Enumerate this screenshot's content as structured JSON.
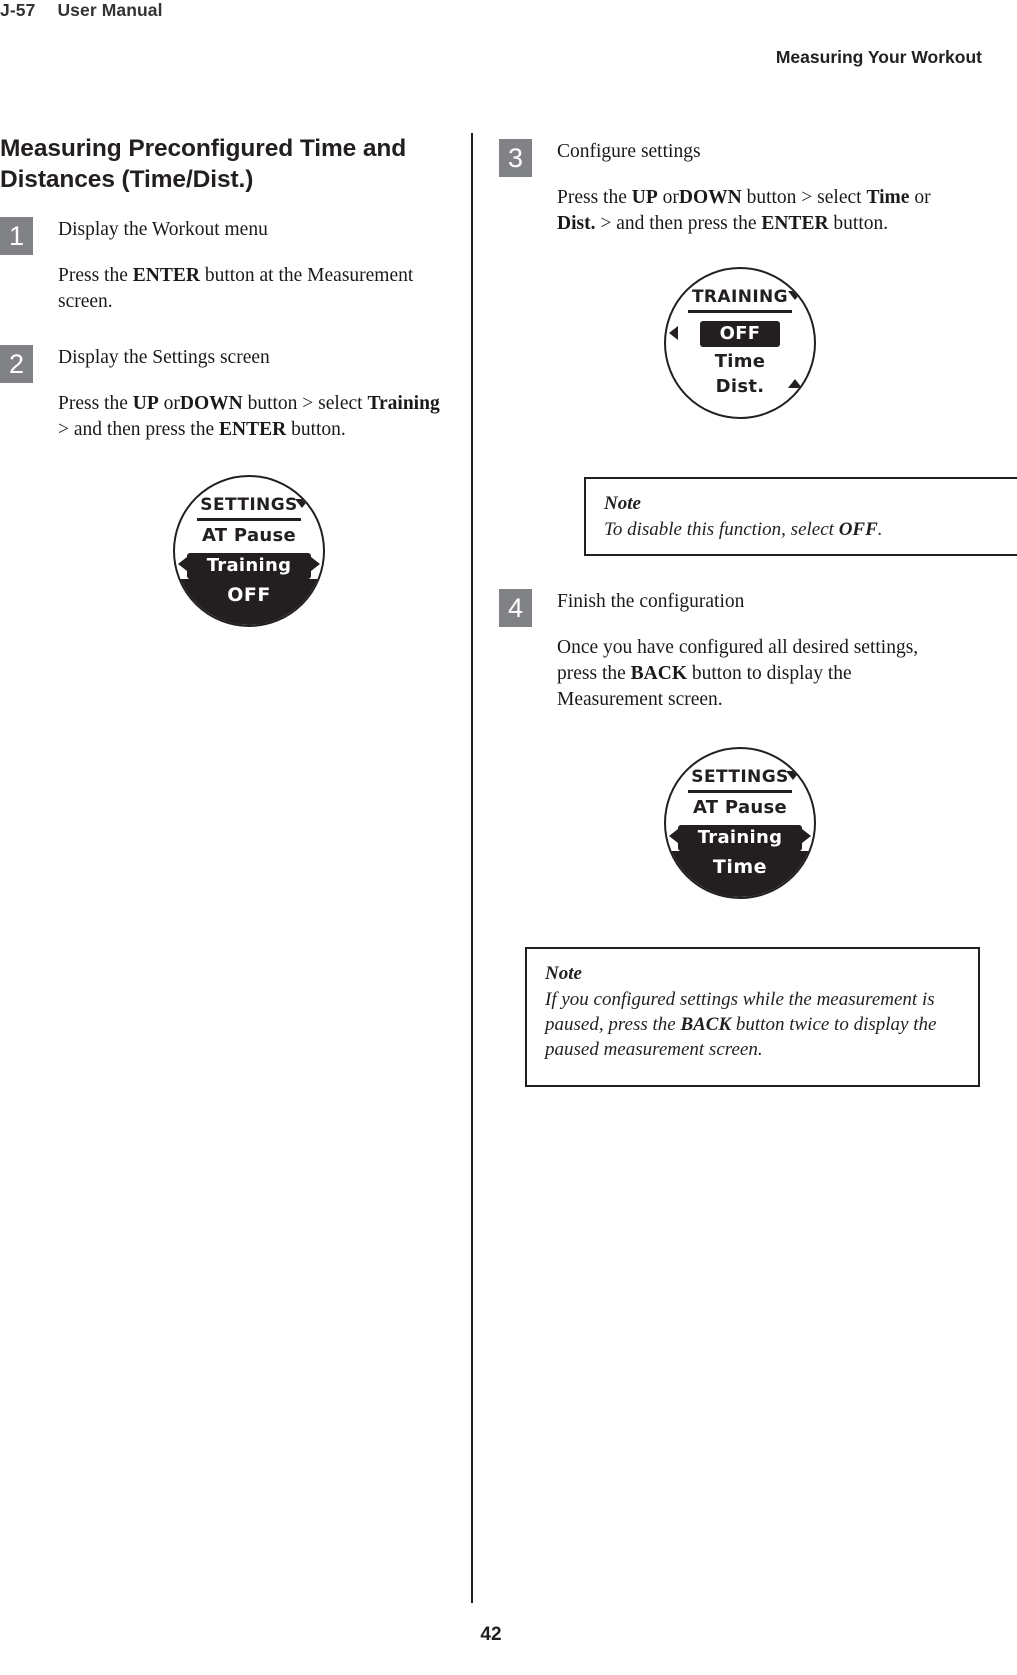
{
  "header": {
    "page_code": "J-57",
    "document_title": "User Manual",
    "chapter": "Measuring Your Workout"
  },
  "footer": {
    "page_number": "42"
  },
  "section": {
    "title": "Measuring Preconfigured Time and Distances (Time/Dist.)"
  },
  "steps": [
    {
      "number": "1",
      "title": "Display the Workout menu",
      "text_parts": [
        {
          "t": "Press the ",
          "b": false
        },
        {
          "t": "ENTER",
          "b": true
        },
        {
          "t": " button at the Measurement screen.",
          "b": false
        }
      ]
    },
    {
      "number": "2",
      "title": "Display the Settings screen",
      "text_parts": [
        {
          "t": "Press the ",
          "b": false
        },
        {
          "t": "UP",
          "b": true
        },
        {
          "t": " or",
          "b": false
        },
        {
          "t": "DOWN",
          "b": true
        },
        {
          "t": " button > select ",
          "b": false
        },
        {
          "t": "Training",
          "b": true
        },
        {
          "t": " > and then press the ",
          "b": false
        },
        {
          "t": "ENTER",
          "b": true
        },
        {
          "t": " button.",
          "b": false
        }
      ]
    },
    {
      "number": "3",
      "title": "Configure settings",
      "text_parts": [
        {
          "t": "Press the ",
          "b": false
        },
        {
          "t": "UP",
          "b": true
        },
        {
          "t": " or",
          "b": false
        },
        {
          "t": "DOWN",
          "b": true
        },
        {
          "t": " button > select ",
          "b": false
        },
        {
          "t": "Time",
          "b": true
        },
        {
          "t": " or ",
          "b": false
        },
        {
          "t": "Dist.",
          "b": true
        },
        {
          "t": " > and then press the ",
          "b": false
        },
        {
          "t": "ENTER",
          "b": true
        },
        {
          "t": " button.",
          "b": false
        }
      ]
    },
    {
      "number": "4",
      "title": "Finish the configuration",
      "text_parts": [
        {
          "t": "Once you have configured all desired settings, press the ",
          "b": false
        },
        {
          "t": "BACK",
          "b": true
        },
        {
          "t": " button to display the Measurement screen.",
          "b": false
        }
      ]
    }
  ],
  "figures": {
    "settings_off": {
      "header": "SETTINGS",
      "rows": [
        {
          "label": "AT Pause",
          "selected": false
        },
        {
          "label": "Training",
          "selected": true
        }
      ],
      "band_label": "OFF",
      "arrows": [
        "down-right",
        "left",
        "right"
      ]
    },
    "training_menu": {
      "header": "TRAINING",
      "rows": [
        {
          "label": "OFF",
          "selected": true
        },
        {
          "label": "Time",
          "selected": false
        },
        {
          "label": "Dist.",
          "selected": false
        }
      ],
      "band_label": "",
      "arrows": [
        "down-right",
        "left",
        "up-right"
      ]
    },
    "settings_time": {
      "header": "SETTINGS",
      "rows": [
        {
          "label": "AT Pause",
          "selected": false
        },
        {
          "label": "Training",
          "selected": true
        }
      ],
      "band_label": "Time",
      "arrows": [
        "down-right",
        "left",
        "right"
      ]
    }
  },
  "notes": [
    {
      "title": "Note",
      "text_parts": [
        {
          "t": "To disable this function, select ",
          "b": false
        },
        {
          "t": "OFF",
          "b": true
        },
        {
          "t": ".",
          "b": false
        }
      ]
    },
    {
      "title": "Note",
      "text_parts": [
        {
          "t": "If you configured settings while the measurement is paused, press the ",
          "b": false
        },
        {
          "t": "BACK",
          "b": true
        },
        {
          "t": " button twice to display the paused measurement screen.",
          "b": false
        }
      ]
    }
  ]
}
